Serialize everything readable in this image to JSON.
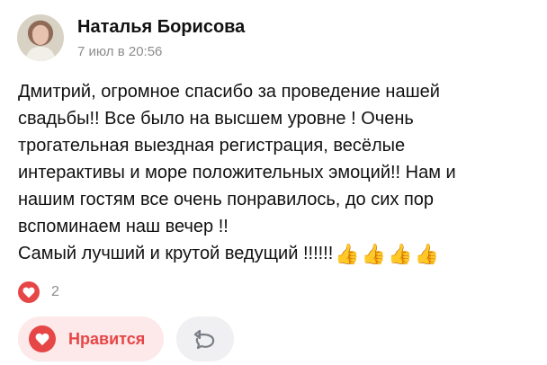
{
  "post": {
    "author": "Наталья Борисова",
    "date": "7 июл в 20:56",
    "lines": [
      "Дмитрий, огромное спасибо за проведение нашей",
      "свадьбы!! Все было на высшем уровне ! Очень",
      "трогательная выездная регистрация, весёлые",
      "интерактивы и море положительных эмоций!! Нам и",
      "нашим гостям все очень понравилось, до сих пор",
      "вспоминаем наш вечер !!",
      "Самый лучший и крутой ведущий !!!!!!"
    ],
    "emoji": [
      "👍",
      "👍",
      "👍",
      "👍"
    ]
  },
  "reactions": {
    "icon": "heart-icon",
    "count": "2"
  },
  "actions": {
    "like_label": "Нравится",
    "like_icon": "heart-icon",
    "repost_icon": "repost-icon"
  },
  "colors": {
    "accent": "#e64646",
    "like_bg": "#fde8ea",
    "muted": "#8d8d8d"
  }
}
